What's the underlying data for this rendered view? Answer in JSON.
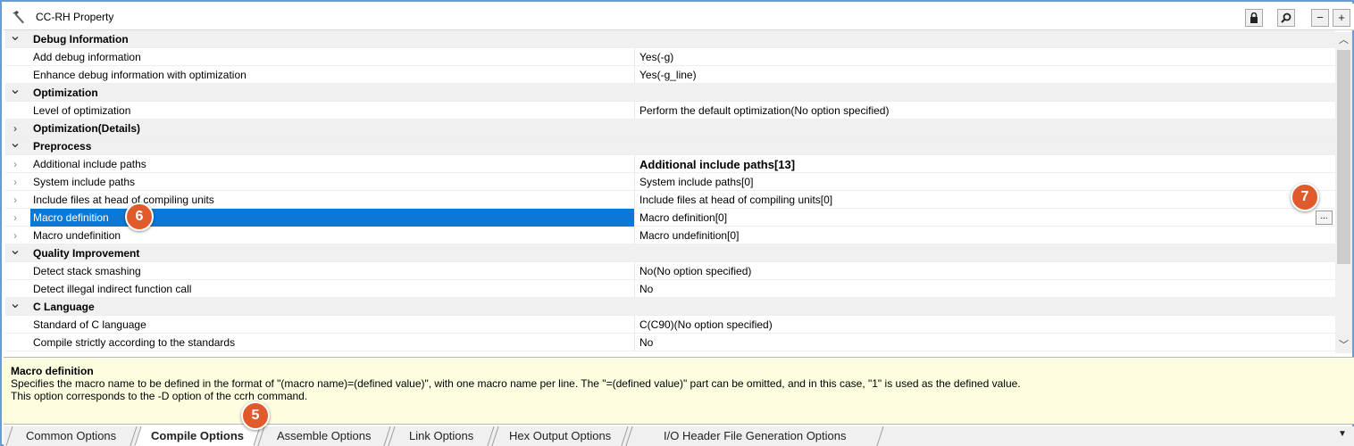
{
  "window": {
    "title": "CC-RH Property"
  },
  "titlebar_buttons": {
    "lock": "🔒",
    "search": "🔍",
    "minus": "−",
    "plus": "+"
  },
  "rows": [
    {
      "type": "cat",
      "expanded": true,
      "name": "Debug Information",
      "value": ""
    },
    {
      "type": "prop",
      "name": "Add debug information",
      "value": "Yes(-g)"
    },
    {
      "type": "prop",
      "name": "Enhance debug information with optimization",
      "value": "Yes(-g_line)"
    },
    {
      "type": "cat",
      "expanded": true,
      "name": "Optimization",
      "value": ""
    },
    {
      "type": "prop",
      "name": "Level of optimization",
      "value": "Perform the default optimization(No option specified)"
    },
    {
      "type": "cat",
      "expanded": false,
      "name": "Optimization(Details)",
      "value": ""
    },
    {
      "type": "cat",
      "expanded": true,
      "name": "Preprocess",
      "value": ""
    },
    {
      "type": "prop",
      "expandable": true,
      "name": "Additional include paths",
      "value": "Additional include paths[13]",
      "bold": true
    },
    {
      "type": "prop",
      "expandable": true,
      "name": "System include paths",
      "value": "System include paths[0]"
    },
    {
      "type": "prop",
      "expandable": true,
      "name": "Include files at head of compiling units",
      "value": "Include files at head of compiling units[0]"
    },
    {
      "type": "prop",
      "expandable": true,
      "name": "Macro definition",
      "value": "Macro definition[0]",
      "selected": true
    },
    {
      "type": "prop",
      "expandable": true,
      "name": "Macro undefinition",
      "value": "Macro undefinition[0]"
    },
    {
      "type": "cat",
      "expanded": true,
      "name": "Quality Improvement",
      "value": ""
    },
    {
      "type": "prop",
      "name": "Detect stack smashing",
      "value": "No(No option specified)"
    },
    {
      "type": "prop",
      "name": "Detect illegal indirect function call",
      "value": "No"
    },
    {
      "type": "cat",
      "expanded": true,
      "name": "C Language",
      "value": ""
    },
    {
      "type": "prop",
      "name": "Standard of C language",
      "value": "C(C90)(No option specified)"
    },
    {
      "type": "prop",
      "name": "Compile strictly according to the standards",
      "value": "No"
    }
  ],
  "ellipsis_label": "...",
  "description": {
    "title": "Macro definition",
    "line1": "Specifies the macro name to be defined in the format of \"(macro name)=(defined value)\", with one macro name per line. The \"=(defined value)\" part can be omitted, and in this case, \"1\" is used as the defined value.",
    "line2": "This option corresponds to the -D option of the ccrh command."
  },
  "tabs": [
    {
      "label": "Common Options",
      "active": false
    },
    {
      "label": "Compile Options",
      "active": true
    },
    {
      "label": "Assemble Options",
      "active": false
    },
    {
      "label": "Link Options",
      "active": false
    },
    {
      "label": "Hex Output Options",
      "active": false
    },
    {
      "label": "I/O Header File Generation Options",
      "active": false
    }
  ],
  "callouts": [
    "6",
    "7",
    "5"
  ],
  "icons": {
    "expanded": "chevron-down-icon",
    "collapsed": "chevron-right-icon"
  },
  "colors": {
    "accent": "#0a78d7",
    "callout": "#e05a2b",
    "description_bg": "#fdfde0"
  }
}
